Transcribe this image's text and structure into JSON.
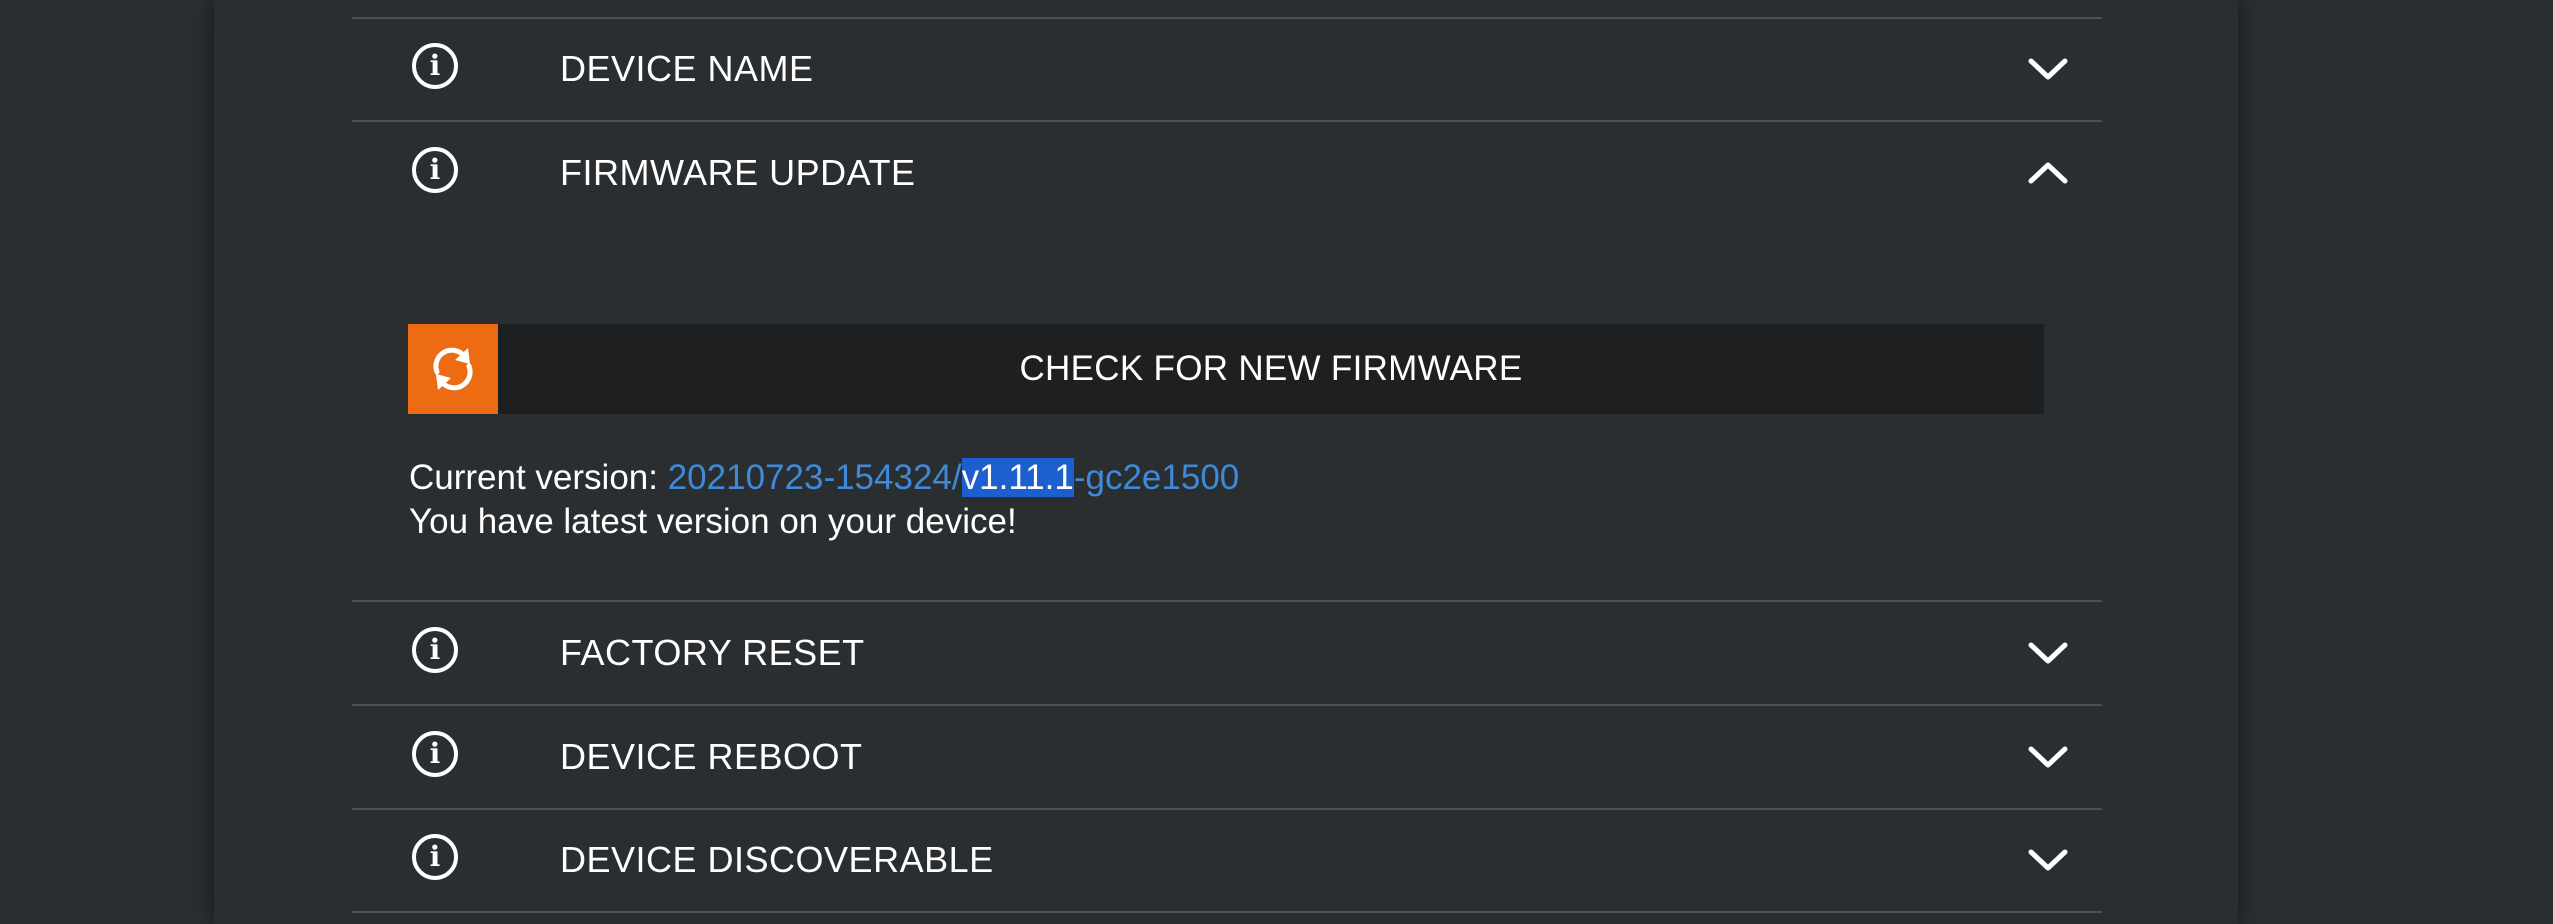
{
  "settings": {
    "sections": [
      {
        "label": "DEVICE NAME",
        "icon": "info-icon",
        "chevron": "chevron-down-icon",
        "expanded": false
      },
      {
        "label": "FIRMWARE UPDATE",
        "icon": "info-icon",
        "chevron": "chevron-up-icon",
        "expanded": true
      },
      {
        "label": "FACTORY RESET",
        "icon": "info-icon",
        "chevron": "chevron-down-icon",
        "expanded": false
      },
      {
        "label": "DEVICE REBOOT",
        "icon": "info-icon",
        "chevron": "chevron-down-icon",
        "expanded": false
      },
      {
        "label": "DEVICE DISCOVERABLE",
        "icon": "info-icon",
        "chevron": "chevron-down-icon",
        "expanded": false
      }
    ]
  },
  "firmware": {
    "check_button_label": "CHECK FOR NEW FIRMWARE",
    "check_button_icon": "refresh-icon",
    "current_version_label": "Current version: ",
    "version_prefix": "20210723-154324/",
    "version_selected": "v1.11.1",
    "version_suffix": "-gc2e1500",
    "status_message": "You have latest version on your device!"
  },
  "colors": {
    "background": "#2b2f33",
    "panel": "#2a2e31",
    "accent_orange": "#ec6b13",
    "link_blue": "#3f8ad8",
    "selection": "#1e5fd0",
    "button_bg": "#1d1f21"
  },
  "info_glyph": "i"
}
